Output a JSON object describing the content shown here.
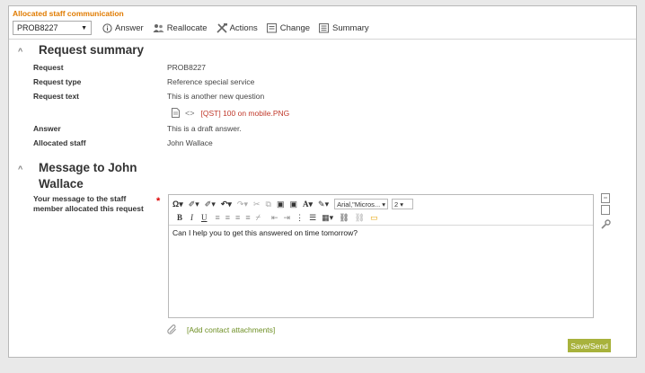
{
  "window": {
    "title": "Allocated staff communication"
  },
  "toolbar": {
    "request_select": "PROB8227",
    "answer": "Answer",
    "reallocate": "Reallocate",
    "actions": "Actions",
    "change": "Change",
    "summary": "Summary"
  },
  "request_summary": {
    "heading": "Request summary",
    "rows": [
      {
        "label": "Request",
        "value": "PROB8227"
      },
      {
        "label": "Request type",
        "value": "Reference special service"
      },
      {
        "label": "Request text",
        "value": "This is another new question"
      },
      {
        "label": "Answer",
        "value": "This is a draft answer."
      },
      {
        "label": "Allocated staff",
        "value": "John Wallace"
      }
    ],
    "attachment": "[QST] 100 on mobile.PNG"
  },
  "message": {
    "heading_line1": "Message to John",
    "heading_line2": "Wallace",
    "field_label_line1": "Your message to the staff",
    "field_label_line2": "member allocated this request",
    "required_mark": "*",
    "body_text": "Can I help you to get this answered on time tomorrow?",
    "font_name": "Arial,\"Micros...",
    "font_size": "2",
    "add_attachments": "[Add contact attachments]",
    "send_label": "Save/Send"
  },
  "colors": {
    "title": "#e07b00",
    "attachment": "#c0392b",
    "link": "#6e8f24",
    "send_button": "#a8b23c"
  }
}
